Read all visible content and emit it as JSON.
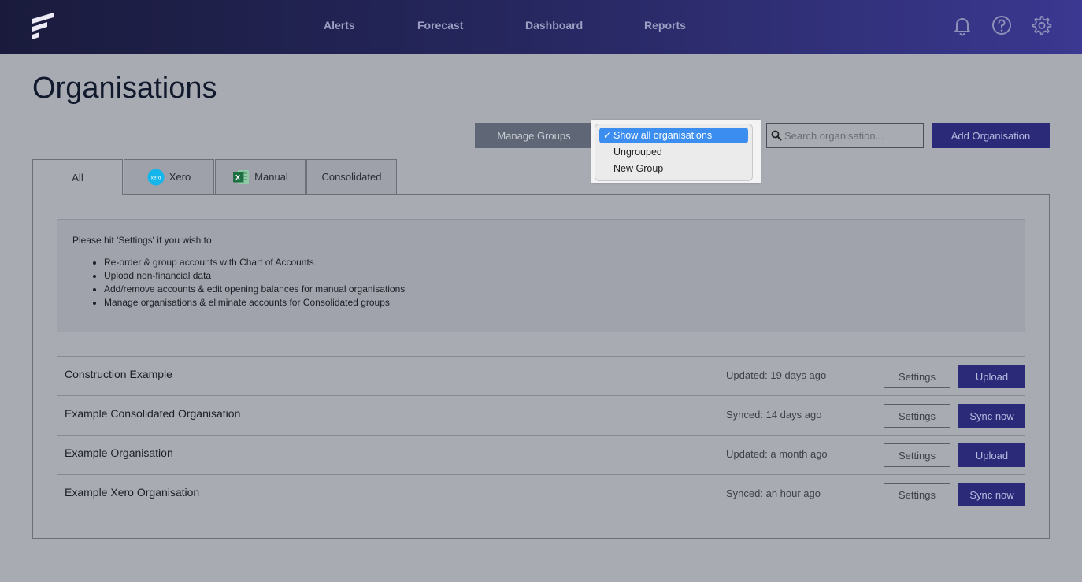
{
  "nav": {
    "items": [
      "Alerts",
      "Forecast",
      "Dashboard",
      "Reports"
    ],
    "icons": [
      "bell-icon",
      "help-icon",
      "gear-icon"
    ],
    "background_colors": [
      "#1a1b3c",
      "#3a3890"
    ]
  },
  "page": {
    "title": "Organisations"
  },
  "toolbar": {
    "manage_groups_label": "Manage Groups",
    "add_org_label": "Add Organisation",
    "search_placeholder": "Search organisation...",
    "group_select": {
      "selected": "Show all organisations",
      "options": [
        "Show all organisations",
        "Ungrouped",
        "New Group"
      ],
      "check_mark": "✓"
    }
  },
  "tabs": [
    {
      "label": "All",
      "active": true
    },
    {
      "label": "Xero",
      "icon": "xero-icon",
      "icon_text": "xero"
    },
    {
      "label": "Manual",
      "icon": "excel-icon",
      "icon_text": "X"
    },
    {
      "label": "Consolidated"
    }
  ],
  "info": {
    "intro": "Please hit 'Settings' if you wish to",
    "bullets": [
      "Re-order & group accounts with Chart of Accounts",
      "Upload non-financial data",
      "Add/remove accounts & edit opening balances for manual organisations",
      "Manage organisations & eliminate accounts for Consolidated groups"
    ]
  },
  "organisations": [
    {
      "name": "Construction Example",
      "status": "Updated: 19 days ago",
      "settings_label": "Settings",
      "action_label": "Upload"
    },
    {
      "name": "Example Consolidated Organisation",
      "status": "Synced: 14 days ago",
      "settings_label": "Settings",
      "action_label": "Sync now"
    },
    {
      "name": "Example Organisation",
      "status": "Updated: a month ago",
      "settings_label": "Settings",
      "action_label": "Upload"
    },
    {
      "name": "Example Xero Organisation",
      "status": "Synced: an hour ago",
      "settings_label": "Settings",
      "action_label": "Sync now"
    }
  ],
  "colors": {
    "primary": "#2a2a78",
    "selected_option": "#3b8ef0",
    "xero": "#13b5ea",
    "excel": "#1d6f42"
  }
}
